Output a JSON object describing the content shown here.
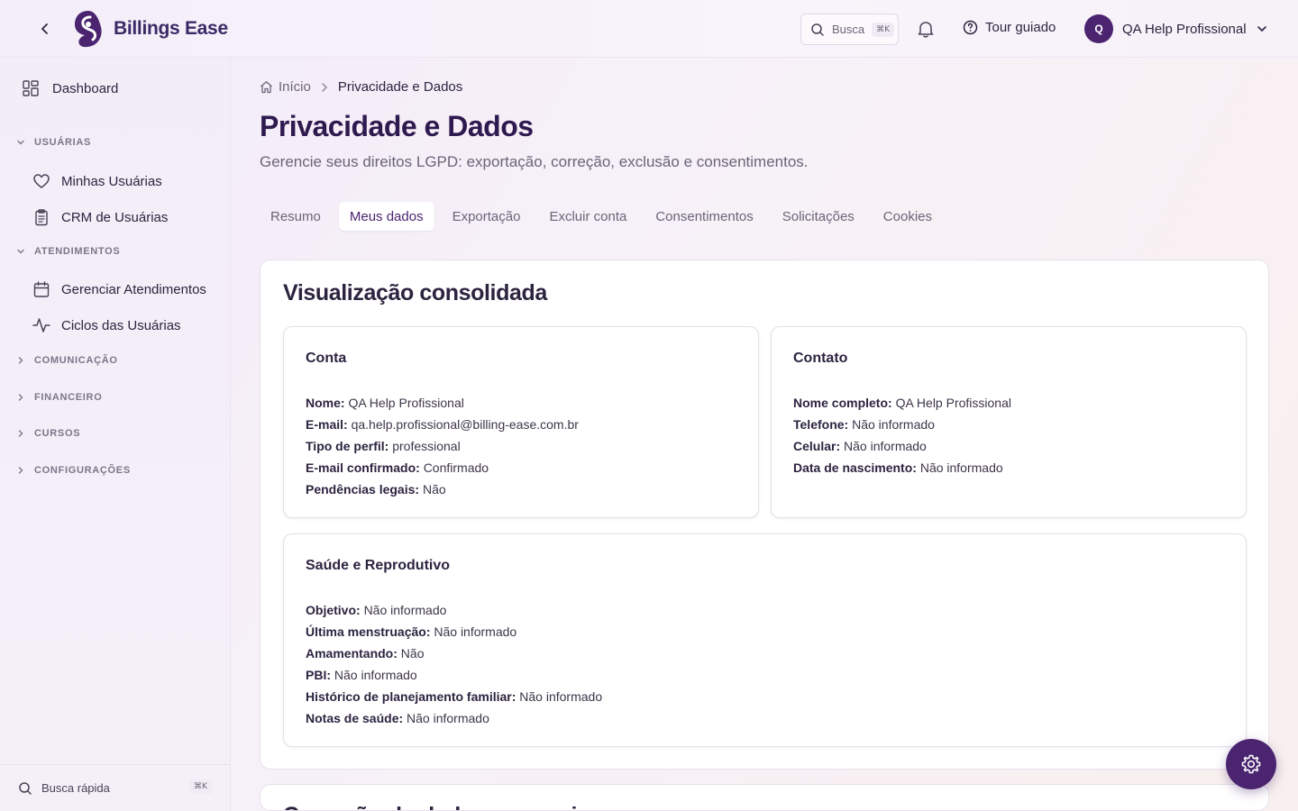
{
  "header": {
    "brand": "Billings Ease",
    "search_label": "Busca",
    "search_shortcut": "⌘K",
    "tour_label": "Tour guiado",
    "user_initial": "Q",
    "user_name": "QA Help Profissional"
  },
  "sidebar": {
    "dashboard": "Dashboard",
    "groups": [
      {
        "label": "USUÁRIAS",
        "expanded": true,
        "items": [
          "Minhas Usuárias",
          "CRM de Usuárias"
        ]
      },
      {
        "label": "ATENDIMENTOS",
        "expanded": true,
        "items": [
          "Gerenciar Atendimentos",
          "Ciclos das Usuárias"
        ]
      },
      {
        "label": "COMUNICAÇÃO",
        "expanded": false
      },
      {
        "label": "FINANCEIRO",
        "expanded": false
      },
      {
        "label": "CURSOS",
        "expanded": false
      },
      {
        "label": "CONFIGURAÇÕES",
        "expanded": false
      }
    ],
    "quick_search": "Busca rápida",
    "quick_search_shortcut": "⌘K"
  },
  "breadcrumb": {
    "home": "Início",
    "current": "Privacidade e Dados"
  },
  "page": {
    "title": "Privacidade e Dados",
    "subtitle": "Gerencie seus direitos LGPD: exportação, correção, exclusão e consentimentos."
  },
  "tabs": [
    "Resumo",
    "Meus dados",
    "Exportação",
    "Excluir conta",
    "Consentimentos",
    "Solicitações",
    "Cookies"
  ],
  "active_tab": "Meus dados",
  "panel": {
    "title": "Visualização consolidada",
    "cards": {
      "conta": {
        "title": "Conta",
        "rows": [
          {
            "k": "Nome:",
            "v": "QA Help Profissional"
          },
          {
            "k": "E-mail:",
            "v": "qa.help.profissional@billing-ease.com.br"
          },
          {
            "k": "Tipo de perfil:",
            "v": "professional"
          },
          {
            "k": "E-mail confirmado:",
            "v": "Confirmado"
          },
          {
            "k": "Pendências legais:",
            "v": "Não"
          }
        ]
      },
      "contato": {
        "title": "Contato",
        "rows": [
          {
            "k": "Nome completo:",
            "v": "QA Help Profissional"
          },
          {
            "k": "Telefone:",
            "v": "Não informado"
          },
          {
            "k": "Celular:",
            "v": "Não informado"
          },
          {
            "k": "Data de nascimento:",
            "v": "Não informado"
          }
        ]
      },
      "saude": {
        "title": "Saúde e Reprodutivo",
        "rows": [
          {
            "k": "Objetivo:",
            "v": "Não informado"
          },
          {
            "k": "Última menstruação:",
            "v": "Não informado"
          },
          {
            "k": "Amamentando:",
            "v": "Não"
          },
          {
            "k": "PBI:",
            "v": "Não informado"
          },
          {
            "k": "Histórico de planejamento familiar:",
            "v": "Não informado"
          },
          {
            "k": "Notas de saúde:",
            "v": "Não informado"
          }
        ]
      }
    }
  },
  "panel2": {
    "title": "Correção de dados pessoais"
  },
  "colors": {
    "brand": "#4b2470",
    "title": "#2e1a4f",
    "muted": "#6b6478"
  },
  "icons": [
    "back-arrow-icon",
    "brand-logo-icon",
    "search-icon",
    "bell-icon",
    "help-circle-icon",
    "chevron-down-icon",
    "dashboard-grid-icon",
    "heart-icon",
    "clipboard-icon",
    "calendar-icon",
    "activity-icon",
    "home-icon",
    "chevron-right-icon",
    "gear-icon"
  ]
}
